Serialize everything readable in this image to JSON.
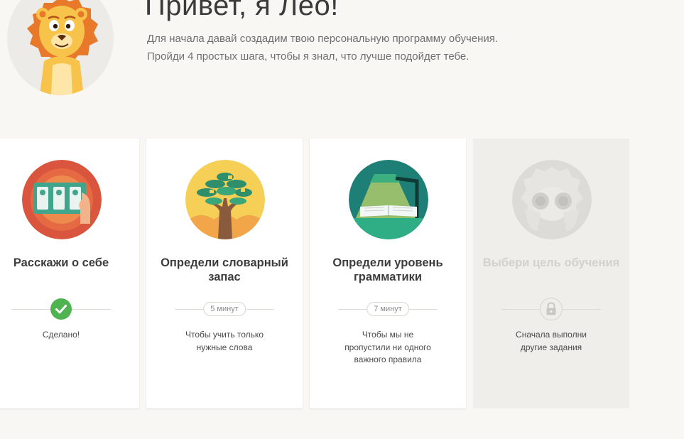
{
  "header": {
    "title": "Привет, я Лео!",
    "subtitle_line1": "Для начала давай создадим твою персональную программу обучения.",
    "subtitle_line2": "Пройди 4 простых шага, чтобы я знал, что лучше подойдет тебе."
  },
  "steps": [
    {
      "title": "Расскажи о себе",
      "status": "Сделано!",
      "state": "done",
      "icon": "form-checklist-icon"
    },
    {
      "title_line1": "Определи словарный",
      "title_line2": "запас",
      "duration": "5 минут",
      "desc_line1": "Чтобы учить только",
      "desc_line2": "нужные слова",
      "state": "available",
      "icon": "tree-icon"
    },
    {
      "title_line1": "Определи уровень",
      "title_line2": "грамматики",
      "duration": "7 минут",
      "desc_line1": "Чтобы мы не",
      "desc_line2": "пропустили ни одного",
      "desc_line3": "важного правила",
      "state": "available",
      "icon": "lamp-book-icon"
    },
    {
      "title": "Выбери цель обучения",
      "desc_line1": "Сначала выполни",
      "desc_line2": "другие задания",
      "state": "locked",
      "icon": "binoculars-icon"
    }
  ],
  "colors": {
    "background": "#f8f7f3",
    "done_green": "#4fb34f",
    "card": "#ffffff",
    "locked_card": "#efeeea"
  }
}
